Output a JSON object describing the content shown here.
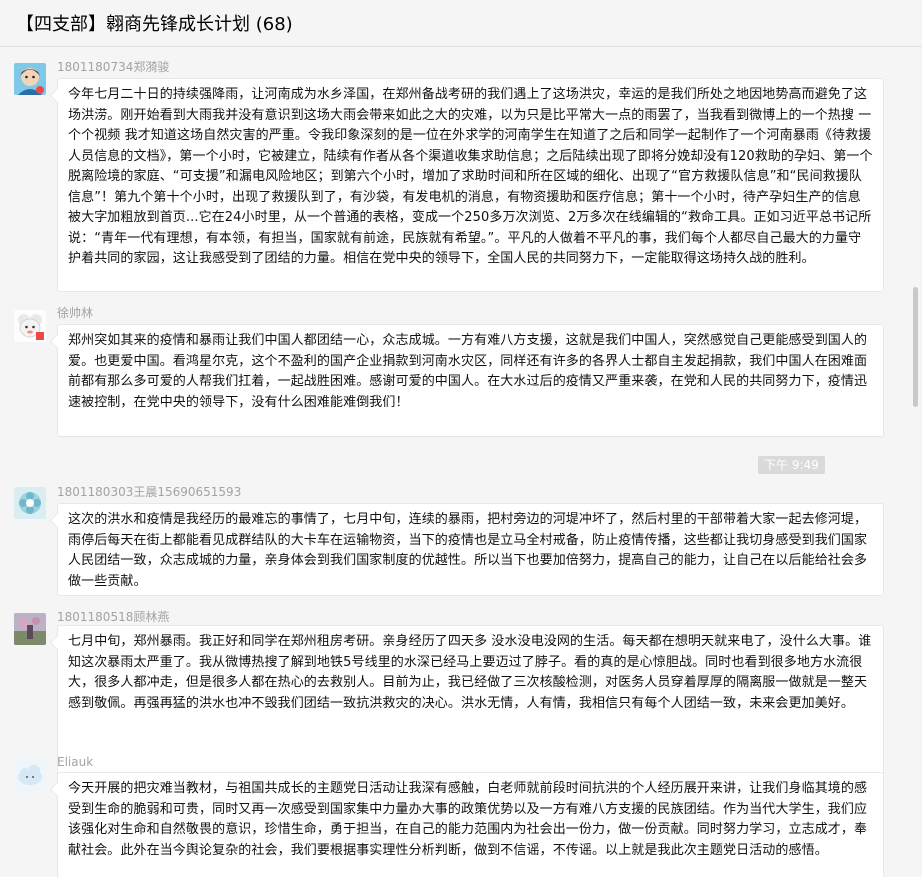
{
  "title": "【四支部】翱商先锋成长计划 (68)",
  "messages": [
    {
      "sender": "1801180734郑漪骏",
      "avatar": "cartoon-avatar-icon",
      "text": "今年七月二十日的持续强降雨，让河南成为水乡泽国，在郑州备战考研的我们遇上了这场洪灾，幸运的是我们所处之地因地势高而避免了这场洪涝。刚开始看到大雨我并没有意识到这场大雨会带来如此之大的灾难，以为只是比平常大一点的雨罢了，当我看到微博上的一个热搜 一个个视频 我才知道这场自然灾害的严重。令我印象深刻的是一位在外求学的河南学生在知道了之后和同学一起制作了一个河南暴雨《待救援人员信息的文档》，第一个小时，它被建立，陆续有作者从各个渠道收集求助信息；之后陆续出现了即将分娩却没有120救助的孕妇、第一个脱离险境的家庭、“可支援”和漏电风险地区；到第六个小时，增加了求助时间和所在区域的细化、出现了“官方救援队信息”和“民间救援队信息”！第九个第十个小时，出现了救援队到了，有沙袋，有发电机的消息，有物资援助和医疗信息；第十一个小时，待产孕妇生产的信息被大字加粗放到首页...它在24小时里，从一个普通的表格，变成一个250多万次浏览、2万多次在线编辑的“救命工具。正如习近平总书记所说：“青年一代有理想，有本领，有担当，国家就有前途，民族就有希望。”。平凡的人做着不平凡的事，我们每个人都尽自己最大的力量守护着共同的家园，这让我感受到了团结的力量。相信在党中央的领导下，全国人民的共同努力下，一定能取得这场持久战的胜利。"
    },
    {
      "sender": "徐帅林",
      "avatar": "cartoon-sheep-avatar-icon",
      "text": "郑州突如其来的疫情和暴雨让我们中国人都团结一心，众志成城。一方有难八方支援，这就是我们中国人，突然感觉自己更能感受到国人的爱。也更爱中国。看鸿星尔克，这个不盈利的国产企业捐款到河南水灾区，同样还有许多的各界人士都自主发起捐款，我们中国人在困难面前都有那么多可爱的人帮我们扛着，一起战胜困难。感谢可爱的中国人。在大水过后的疫情又严重来袭，在党和人民的共同努力下，疫情迅速被控制，在党中央的领导下，没有什么困难能难倒我们！"
    },
    {
      "sender": "1801180303王晨15690651593",
      "avatar": "flower-avatar-icon",
      "text": "这次的洪水和疫情是我经历的最难忘的事情了，七月中旬，连续的暴雨，把村旁边的河堤冲坏了，然后村里的干部带着大家一起去修河堤，雨停后每天在街上都能看见成群结队的大卡车在运输物资，当下的疫情也是立马全村戒备，防止疫情传播，这些都让我切身感受到我们国家人民团结一致，众志成城的力量，亲身体会到我们国家制度的优越性。所以当下也要加倍努力，提高自己的能力，让自己在以后能给社会多做一些贡献。"
    },
    {
      "sender": "1801180518顾林燕",
      "avatar": "photo-avatar-icon",
      "text": "七月中旬，郑州暴雨。我正好和同学在郑州租房考研。亲身经历了四天多 没水没电没网的生活。每天都在想明天就来电了，没什么大事。谁知这次暴雨太严重了。我从微博热搜了解到地铁5号线里的水深已经马上要迈过了脖子。看的真的是心惊胆战。同时也看到很多地方水流很大，很多人都冲走，但是很多人都在热心的去救别人。目前为止，我已经做了三次核酸检测，对医务人员穿着厚厚的隔离服一做就是一整天感到敬佩。再强再猛的洪水也冲不毁我们团结一致抗洪救灾的决心。洪水无情，人有情，我相信只有每个人团结一致，未来会更加美好。"
    },
    {
      "sender": "Eliauk",
      "avatar": "cloud-avatar-icon",
      "text": "今天开展的把灾难当教材，与祖国共成长的主题党日活动让我深有感触，白老师就前段时间抗洪的个人经历展开来讲，让我们身临其境的感受到生命的脆弱和可贵，同时又再一次感受到国家集中力量办大事的政策优势以及一方有难八方支援的民族团结。作为当代大学生，我们应该强化对生命和自然敬畏的意识，珍惜生命，勇于担当，在自己的能力范围内为社会出一份力，做一份贡献。同时努力学习，立志成才，奉献社会。此外在当今舆论复杂的社会，我们要根据事实理性分析判断，做到不信谣，不传谣。以上就是我此次主题党日活动的感悟。"
    }
  ],
  "timestamp": "下午 9:49",
  "colors": {
    "background": "#f5f5f5",
    "bubble": "#ffffff",
    "sender": "#a3a3a3",
    "timestamp_bg": "#dadada"
  }
}
